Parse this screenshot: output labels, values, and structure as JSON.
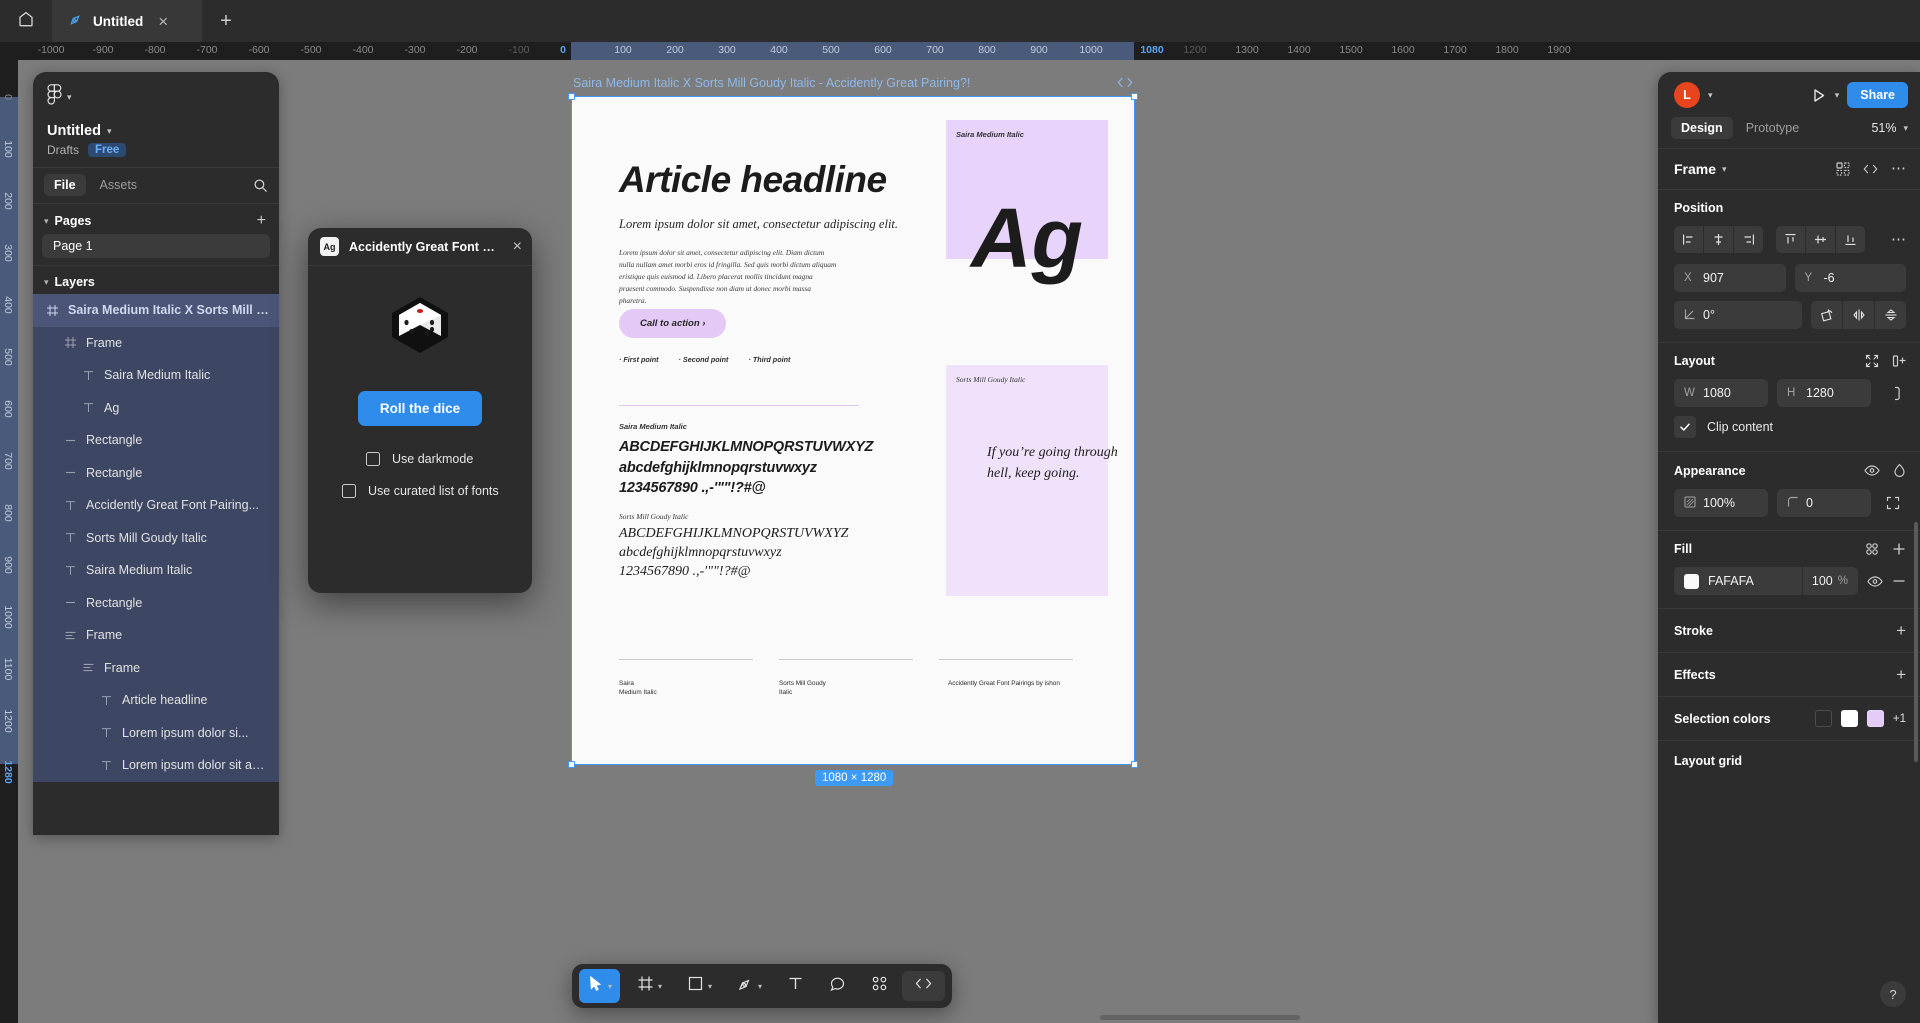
{
  "tabbar": {
    "home_icon": "home-icon",
    "tab_icon": "figma-pen-icon",
    "tab_title": "Untitled",
    "close_icon": "×",
    "new_tab_icon": "+"
  },
  "rulers": {
    "h_ticks": [
      "-1000",
      "-900",
      "-800",
      "-700",
      "-600",
      "-500",
      "-400",
      "-300",
      "-200",
      "-100",
      "0",
      "100",
      "200",
      "300",
      "400",
      "500",
      "600",
      "700",
      "800",
      "900",
      "1000",
      "1080",
      "1200",
      "1300",
      "1400",
      "1500",
      "1600",
      "1700",
      "1800",
      "1900"
    ],
    "h_selected": "1080",
    "h_band_start": "0",
    "h_band_end": "1080",
    "v_ticks": [
      "0",
      "100",
      "200",
      "300",
      "400",
      "500",
      "600",
      "700",
      "800",
      "900",
      "1000",
      "1100",
      "1200",
      "1280"
    ],
    "v_selected": "1280"
  },
  "left_panel": {
    "logo_icon": "figma-logo-icon",
    "logo_chevron": "chevron-down-icon",
    "file_name": "Untitled",
    "file_chevron": "chevron-down-icon",
    "location": "Drafts",
    "plan_badge": "Free",
    "tabs": [
      {
        "label": "File",
        "active": true
      },
      {
        "label": "Assets",
        "active": false
      }
    ],
    "search_icon": "search-icon",
    "pages_section": {
      "title": "Pages",
      "caret": "chevron-down-icon",
      "add_icon": "plus-icon",
      "pages": [
        "Page 1"
      ]
    },
    "layers_section": {
      "title": "Layers",
      "caret": "chevron-down-icon"
    },
    "layers": [
      {
        "name": "Saira Medium Italic X Sorts Mill G...",
        "icon": "frame-icon",
        "indent": 0,
        "state": "selected-head"
      },
      {
        "name": "Frame",
        "icon": "frame-icon",
        "indent": 1,
        "state": "selected"
      },
      {
        "name": "Saira Medium Italic",
        "icon": "text-icon",
        "indent": 2,
        "state": "selected"
      },
      {
        "name": "Ag",
        "icon": "text-icon",
        "indent": 2,
        "state": "selected"
      },
      {
        "name": "Rectangle",
        "icon": "rectangle-icon",
        "indent": 1,
        "state": "selected"
      },
      {
        "name": "Rectangle",
        "icon": "rectangle-icon",
        "indent": 1,
        "state": "selected"
      },
      {
        "name": "Accidently Great Font Pairing...",
        "icon": "text-icon",
        "indent": 1,
        "state": "selected"
      },
      {
        "name": "Sorts Mill Goudy Italic",
        "icon": "text-icon",
        "indent": 1,
        "state": "selected"
      },
      {
        "name": "Saira Medium Italic",
        "icon": "text-icon",
        "indent": 1,
        "state": "selected"
      },
      {
        "name": "Rectangle",
        "icon": "rectangle-icon",
        "indent": 1,
        "state": "selected"
      },
      {
        "name": "Frame",
        "icon": "autolayout-icon",
        "indent": 1,
        "state": "selected"
      },
      {
        "name": "Frame",
        "icon": "autolayout-icon",
        "indent": 2,
        "state": "selected"
      },
      {
        "name": "Article headline",
        "icon": "text-icon",
        "indent": 3,
        "state": "selected"
      },
      {
        "name": "Lorem ipsum dolor si...",
        "icon": "text-icon",
        "indent": 3,
        "state": "selected"
      },
      {
        "name": "Lorem ipsum dolor sit am...",
        "icon": "text-icon",
        "indent": 3,
        "state": "selected"
      }
    ]
  },
  "plugin": {
    "icon_text": "Ag",
    "title": "Accidently Great Font Pai...",
    "close_icon": "×",
    "dice_icon": "dice-icon",
    "roll_button": "Roll the dice",
    "options": [
      {
        "label": "Use darkmode",
        "checked": false
      },
      {
        "label": "Use curated list of fonts",
        "checked": false
      }
    ]
  },
  "canvas": {
    "frame_label": "Saira Medium Italic X Sorts Mill Goudy Italic - Accidently Great Pairing?!",
    "code_icon": "code-icon",
    "dimension_badge": "1080 × 1280",
    "artboard": {
      "headline": "Article headline",
      "deck": "Lorem ipsum dolor sit amet, consectetur adipiscing elit.",
      "body": "Lorem ipsum dolor sit amet, consectetur adipiscing elit. Diam dictum nulla nullam amet morbi eros id fringilla. Sed quis morbi dictum aliquam eristique quis euismod id. Libero placerat mollis tincidunt magna praesent commodo. Suspendisse non diam ut donec morbi massa pharetra.",
      "cta": "Call to action ›",
      "bullets": [
        "· First point",
        "· Second point",
        "· Third point"
      ],
      "spec_sans_label": "Saira Medium Italic",
      "spec_sans_upper": "ABCDEFGHIJKLMNOPQRSTUVWXYZ",
      "spec_sans_lower": "abcdefghijklmnopqrstuvwxyz",
      "spec_sans_nums": "1234567890 .,-'\"\"!?#@",
      "spec_serif_label": "Sorts Mill Goudy Italic",
      "spec_serif_upper": "ABCDEFGHIJKLMNOPQRSTUVWXYZ",
      "spec_serif_lower": "abcdefghijklmnopqrstuvwxyz",
      "spec_serif_nums": "1234567890 .,-'\"\"!?#@",
      "panel1_label": "Saira Medium Italic",
      "panel1_sample": "Ag",
      "panel2_label": "Sorts Mill Goudy Italic",
      "panel2_quote": "If you’re going through hell, keep going.",
      "footer_left": "Saira\nMedium Italic",
      "footer_mid": "Sorts Mill Goudy\nItalic",
      "footer_right": "Accidently Great Font Pairings by ishon"
    }
  },
  "right_panel": {
    "avatar_initial": "L",
    "avatar_chevron": "chevron-down-icon",
    "present_icon": "play-icon",
    "present_chevron": "chevron-down-icon",
    "share_button": "Share",
    "tabs": [
      {
        "label": "Design",
        "active": true
      },
      {
        "label": "Prototype",
        "active": false
      }
    ],
    "zoom_level": "51%",
    "zoom_chevron": "chevron-down-icon",
    "selection_type": "Frame",
    "selection_chevron": "chevron-down-icon",
    "selection_icons": [
      "component-icon",
      "code-icon",
      "more-icon"
    ],
    "position": {
      "title": "Position",
      "align_icons": [
        "align-left-icon",
        "align-horizontal-center-icon",
        "align-right-icon",
        "align-top-icon",
        "align-vertical-center-icon",
        "align-bottom-icon"
      ],
      "more_icon": "more-icon",
      "x_label": "X",
      "x_value": "907",
      "y_label": "Y",
      "y_value": "-6",
      "rotation_icon": "angle-icon",
      "rotation_value": "0°",
      "transform_icons": [
        "rotate-icon",
        "flip-horizontal-icon",
        "flip-vertical-icon"
      ]
    },
    "layout": {
      "title": "Layout",
      "header_icons": [
        "resize-to-fit-icon",
        "add-autolayout-icon"
      ],
      "w_label": "W",
      "w_value": "1080",
      "h_label": "H",
      "h_value": "1280",
      "ratio_icon": "lock-ratio-icon",
      "clip_content_label": "Clip content",
      "clip_content_checked": true
    },
    "appearance": {
      "title": "Appearance",
      "header_icons": [
        "visibility-icon",
        "blend-mode-icon"
      ],
      "opacity_icon": "opacity-icon",
      "opacity_value": "100%",
      "corner_icon": "corner-radius-icon",
      "corner_value": "0",
      "independent_icon": "independent-corners-icon"
    },
    "fill": {
      "title": "Fill",
      "header_icons": [
        "styles-icon",
        "plus-icon"
      ],
      "swatch_color": "#FAFAFA",
      "hex": "FAFAFA",
      "opacity": "100",
      "opacity_unit": "%",
      "visibility_icon": "visibility-icon",
      "remove_icon": "minus-icon"
    },
    "stroke": {
      "title": "Stroke",
      "add_icon": "plus-icon"
    },
    "effects": {
      "title": "Effects",
      "add_icon": "plus-icon"
    },
    "selection_colors": {
      "title": "Selection colors",
      "swatches": [
        "#2b2b2b",
        "#ffffff",
        "#e4ccf7"
      ],
      "more": "+1"
    },
    "layout_grid": {
      "title": "Layout grid"
    },
    "help_icon": "?"
  },
  "toolbar": {
    "items": [
      {
        "icon": "cursor-icon",
        "label": "move-tool",
        "active": true,
        "chevron": true
      },
      {
        "icon": "frame-icon",
        "label": "frame-tool",
        "active": false,
        "chevron": true
      },
      {
        "icon": "square-icon",
        "label": "shape-tool",
        "active": false,
        "chevron": true
      },
      {
        "icon": "pen-icon",
        "label": "pen-tool",
        "active": false,
        "chevron": true
      },
      {
        "icon": "text-icon",
        "label": "text-tool",
        "active": false,
        "chevron": false
      },
      {
        "icon": "comment-icon",
        "label": "comment-tool",
        "active": false,
        "chevron": false
      },
      {
        "icon": "plugin-icon",
        "label": "actions-tool",
        "active": false,
        "chevron": false
      }
    ],
    "code_icon": "code-icon"
  }
}
